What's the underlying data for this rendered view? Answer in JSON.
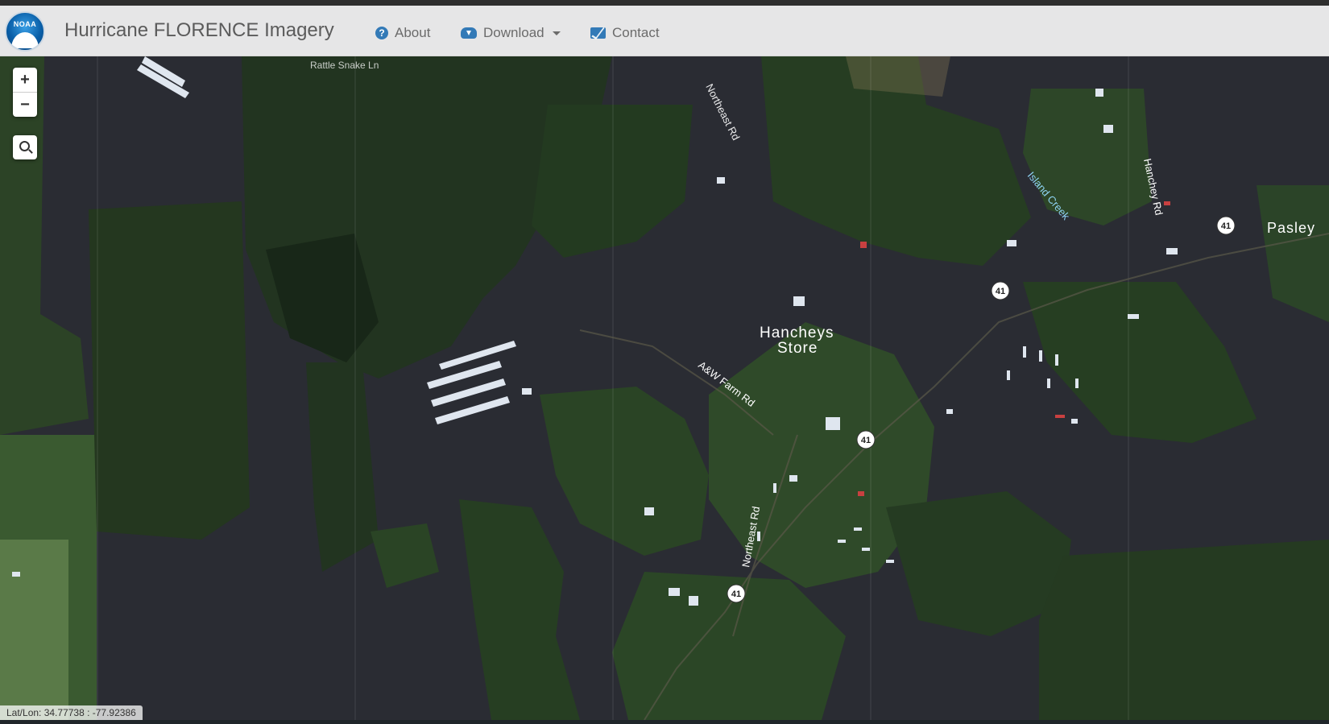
{
  "navbar": {
    "logo_text": "NOAA",
    "brand": "Hurricane FLORENCE Imagery",
    "about_label": "About",
    "download_label": "Download",
    "contact_label": "Contact",
    "about_icon": "question-circle-icon",
    "download_icon": "cloud-download-icon",
    "contact_icon": "envelope-icon",
    "accent_color": "#337ab7"
  },
  "controls": {
    "zoom_in": "+",
    "zoom_out": "−",
    "search_icon": "search-icon"
  },
  "map": {
    "labels": {
      "rattlesnake": "Rattle Snake Ln",
      "northeast_top": "Northeast Rd",
      "island_creek": "Island Creek",
      "hanchey_rd": "Hanchey Rd",
      "pasley": "Pasley",
      "hancheys_1": "Hancheys",
      "hancheys_2": "Store",
      "aw_farm": "A&W Farm Rd",
      "northeast_bottom": "Northeast Rd"
    },
    "route_shield": "41",
    "colors": {
      "water": "#2a2c33",
      "forest": "#24371f",
      "shield": "#ffffff"
    }
  },
  "status": {
    "latlon": "Lat/Lon: 34.77738 : -77.92386"
  }
}
